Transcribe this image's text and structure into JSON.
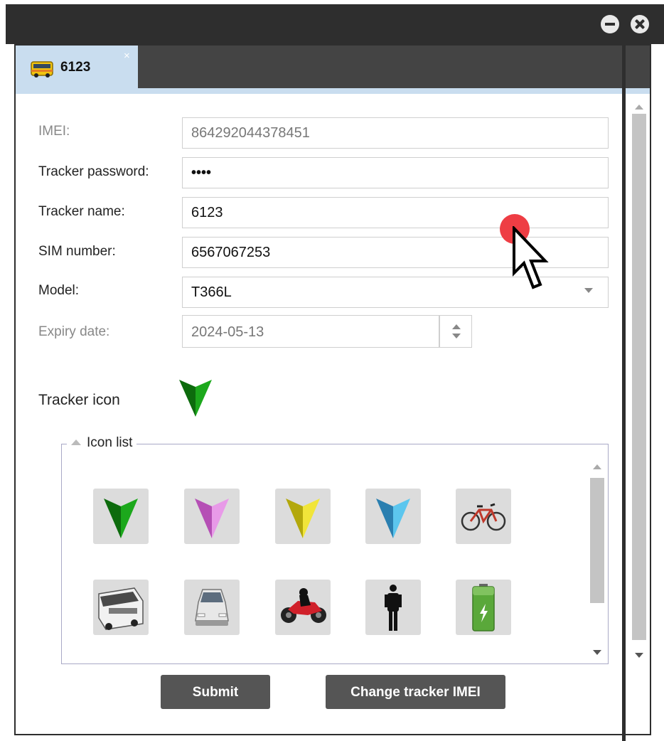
{
  "window": {
    "minimize_icon": "minus-circle-icon",
    "close_icon": "close-circle-icon"
  },
  "tab": {
    "label": "6123",
    "icon": "bus-icon",
    "close_label": "×"
  },
  "form": {
    "imei_label": "IMEI:",
    "imei_value": "864292044378451",
    "password_label": "Tracker password:",
    "password_value": "••••",
    "name_label": "Tracker name:",
    "name_value": "6123",
    "sim_label": "SIM number:",
    "sim_value": "6567067253",
    "model_label": "Model:",
    "model_value": "T366L",
    "expiry_label": "Expiry date:",
    "expiry_value": "2024-05-13"
  },
  "tracker_icon": {
    "label": "Tracker icon",
    "selected": "green-arrow-icon",
    "color": "#1a8a1a"
  },
  "icon_list": {
    "legend": "Icon list",
    "icons": [
      {
        "name": "green-arrow-icon",
        "color": "#1c8a1c"
      },
      {
        "name": "pink-arrow-icon",
        "color": "#d77ad7"
      },
      {
        "name": "yellow-arrow-icon",
        "color": "#e0d414"
      },
      {
        "name": "blue-arrow-icon",
        "color": "#3aa8d8"
      },
      {
        "name": "bicycle-icon",
        "color": "#c0392b"
      },
      {
        "name": "bus-icon",
        "color": "#dddddd"
      },
      {
        "name": "car-icon",
        "color": "#cccccc"
      },
      {
        "name": "motorcycle-icon",
        "color": "#d0202a"
      },
      {
        "name": "person-icon",
        "color": "#111111"
      },
      {
        "name": "battery-icon",
        "color": "#6cc04a"
      }
    ]
  },
  "buttons": {
    "submit": "Submit",
    "change_imei": "Change tracker IMEI"
  }
}
